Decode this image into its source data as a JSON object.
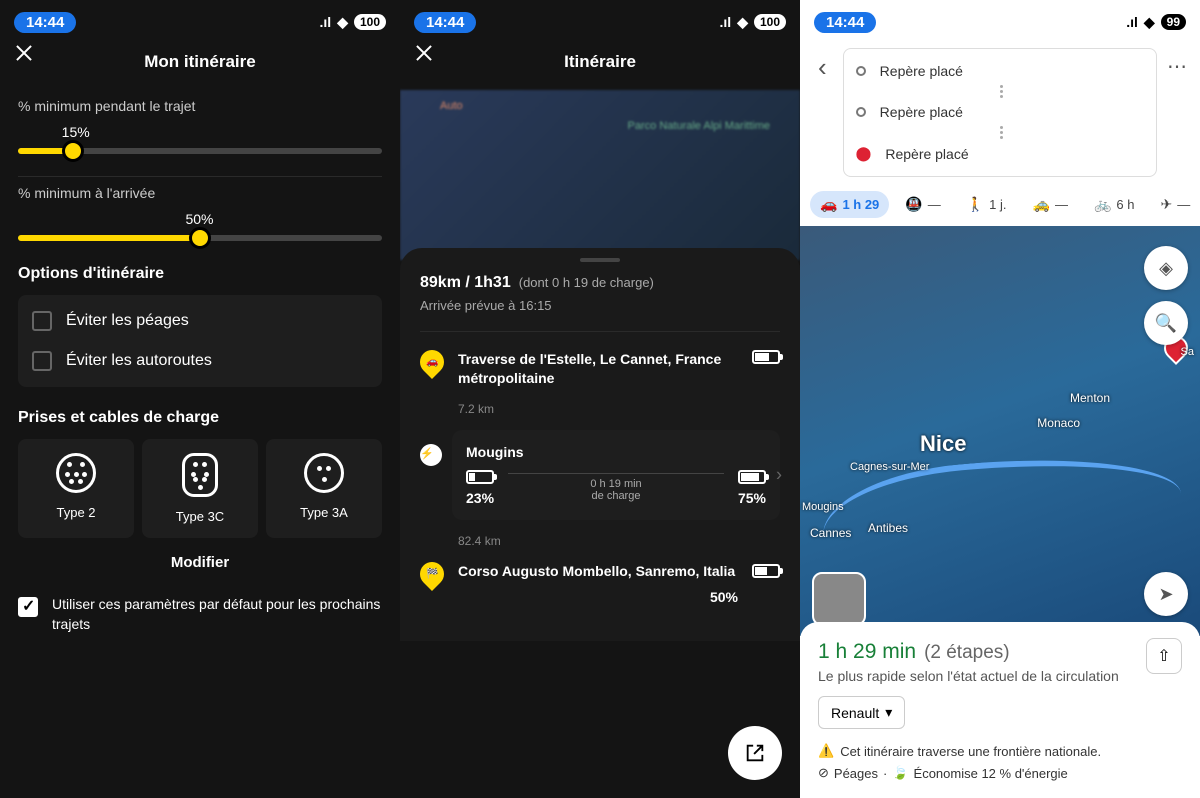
{
  "panel1": {
    "status": {
      "time": "14:44",
      "battery": "100"
    },
    "header": {
      "title": "Mon itinéraire"
    },
    "slider1": {
      "label": "% minimum pendant le trajet",
      "value": "15%",
      "percent": 15
    },
    "slider2": {
      "label": "% minimum à l'arrivée",
      "value": "50%",
      "percent": 50
    },
    "options": {
      "title": "Options d'itinéraire",
      "avoid_tolls": "Éviter les péages",
      "avoid_highways": "Éviter les autoroutes"
    },
    "plugs": {
      "title": "Prises et cables de charge",
      "items": [
        "Type 2",
        "Type 3C",
        "Type 3A"
      ],
      "modify": "Modifier"
    },
    "default_label": "Utiliser ces paramètres par défaut pour les prochains trajets"
  },
  "panel2": {
    "status": {
      "time": "14:44",
      "battery": "100"
    },
    "header": {
      "title": "Itinéraire"
    },
    "summary": {
      "main": "89km / 1h31",
      "charge_note": "(dont 0 h 19 de charge)",
      "arrival": "Arrivée prévue à 16:15"
    },
    "start": {
      "address": "Traverse de l'Estelle, Le Cannet, France métropolitaine",
      "dist_after": "7.2 km"
    },
    "charge": {
      "name": "Mougins",
      "pct_before": "23%",
      "pct_after": "75%",
      "duration_line1": "0 h 19 min",
      "duration_line2": "de charge",
      "dist_after": "82.4 km"
    },
    "dest": {
      "address": "Corso Augusto Mombello, Sanremo, Italia",
      "pct": "50%"
    }
  },
  "panel3": {
    "status": {
      "time": "14:44",
      "battery": "99"
    },
    "waypoints": [
      "Repère placé",
      "Repère placé",
      "Repère placé"
    ],
    "modes": {
      "car": "1 h 29",
      "transit": "—",
      "walk": "1 j.",
      "ride": "—",
      "bike": "6 h",
      "plane": "—"
    },
    "map_labels": {
      "nice": "Nice",
      "menton": "Menton",
      "monaco": "Monaco",
      "cagnes": "Cagnes-sur-Mer",
      "cannes": "Cannes",
      "antibes": "Antibes",
      "mougins": "Mougins",
      "sa": "Sa"
    },
    "result": {
      "time": "1 h 29 min",
      "steps": "(2 étapes)",
      "fastest": "Le plus rapide selon l'état actuel de la circulation",
      "dropdown": "Renault",
      "border_warning": "Cet itinéraire traverse une frontière nationale.",
      "tolls": "Péages",
      "energy": "Économise 12 % d'énergie"
    }
  }
}
